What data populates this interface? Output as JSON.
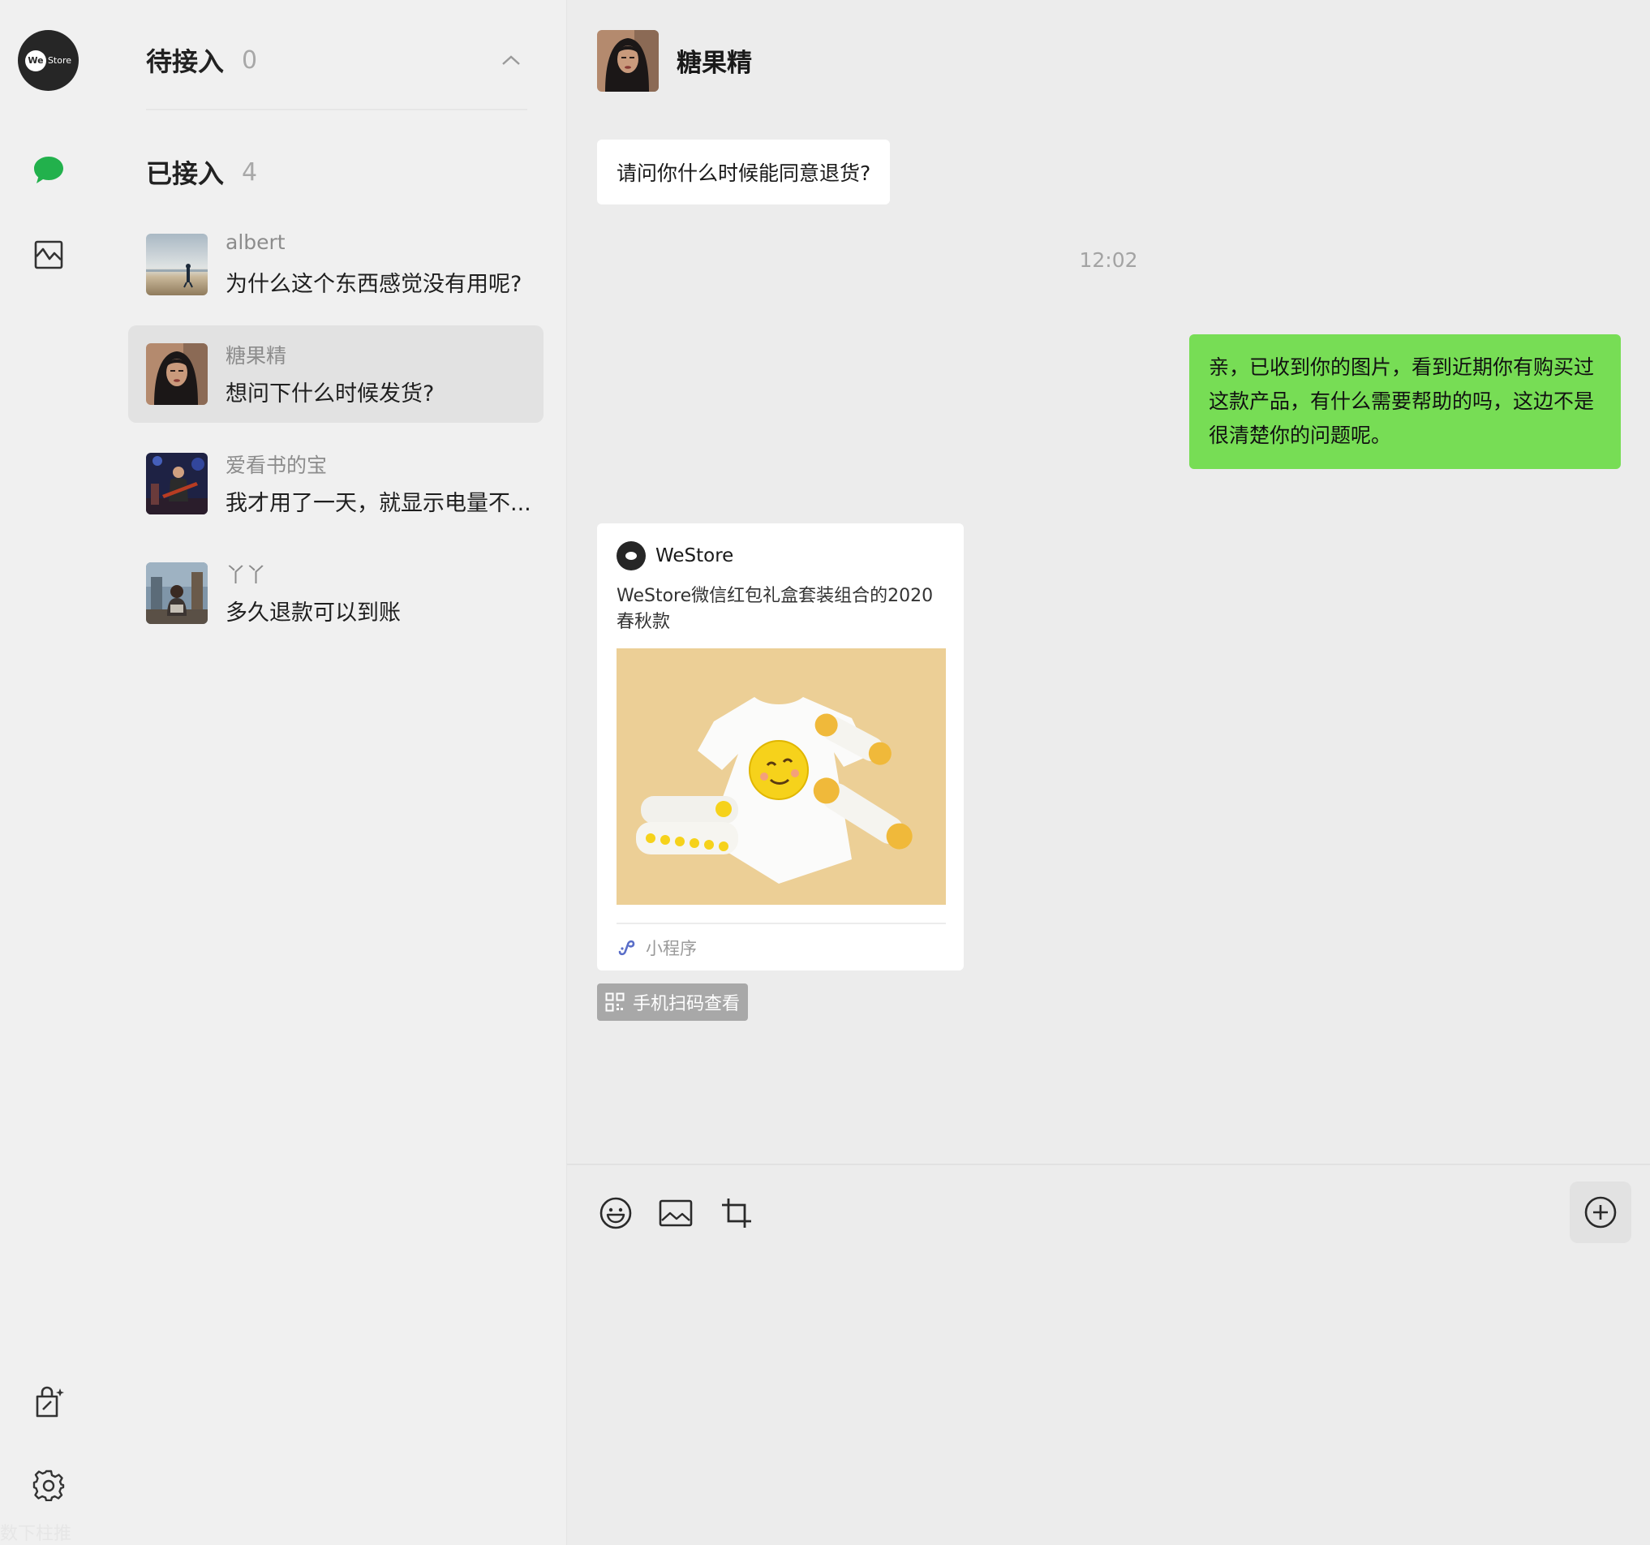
{
  "rail": {
    "logo_we": "We",
    "logo_store": "Store",
    "watermark": "数下柱推"
  },
  "groups": {
    "pending": {
      "title": "待接入",
      "count": "0"
    },
    "accepted": {
      "title": "已接入",
      "count": "4"
    }
  },
  "sessions": [
    {
      "name": "albert",
      "preview": "为什么这个东西感觉没有用呢?",
      "avatar": "beach-person"
    },
    {
      "name": "糖果精",
      "preview": "想问下什么时候发货?",
      "avatar": "woman-portrait",
      "active": true
    },
    {
      "name": "爱看书的宝",
      "preview": "我才用了一天，就显示电量不...",
      "avatar": "guitar-concert"
    },
    {
      "name": "丫丫",
      "preview": "多久退款可以到账",
      "avatar": "street-person"
    }
  ],
  "chat": {
    "contact_name": "糖果精",
    "incoming_message": "请问你什么时候能同意退货?",
    "timestamp": "12:02",
    "outgoing_message": "亲，已收到你的图片，看到近期你有购买过这款产品，有什么需要帮助的吗，这边不是很清楚你的问题呢。",
    "card": {
      "brand": "WeStore",
      "title": "WeStore微信红包礼盒套装组合的2020春秋款",
      "footer_label": "小程序"
    },
    "scan_label": "手机扫码查看",
    "composer_value": ""
  },
  "colors": {
    "outgoing_bubble": "#77dd55",
    "accent_green": "#1aad19"
  }
}
